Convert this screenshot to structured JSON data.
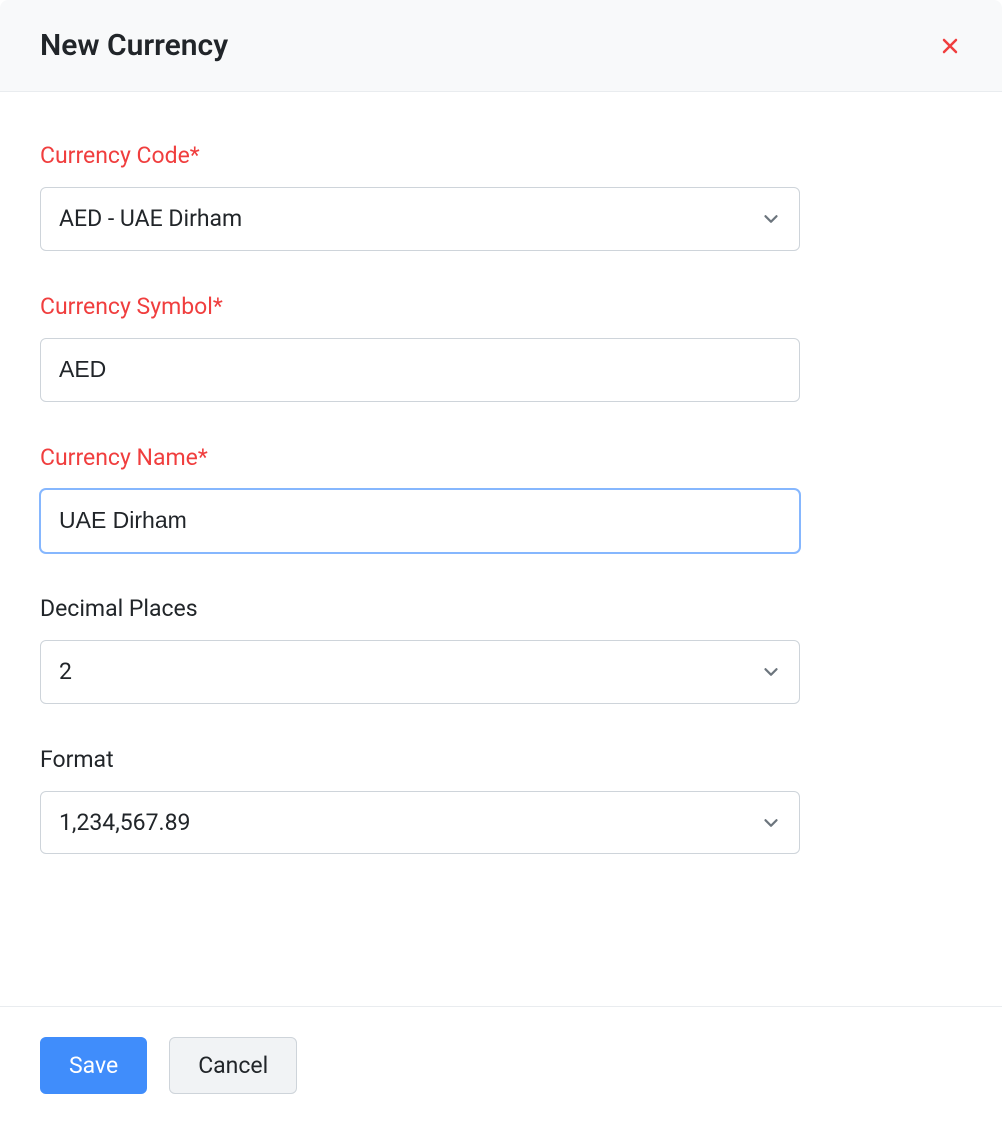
{
  "header": {
    "title": "New Currency"
  },
  "form": {
    "currency_code": {
      "label": "Currency Code*",
      "value": "AED - UAE Dirham"
    },
    "currency_symbol": {
      "label": "Currency Symbol*",
      "value": "AED"
    },
    "currency_name": {
      "label": "Currency Name*",
      "value": "UAE Dirham"
    },
    "decimal_places": {
      "label": "Decimal Places",
      "value": "2"
    },
    "format": {
      "label": "Format",
      "value": "1,234,567.89"
    }
  },
  "footer": {
    "save_label": "Save",
    "cancel_label": "Cancel"
  }
}
